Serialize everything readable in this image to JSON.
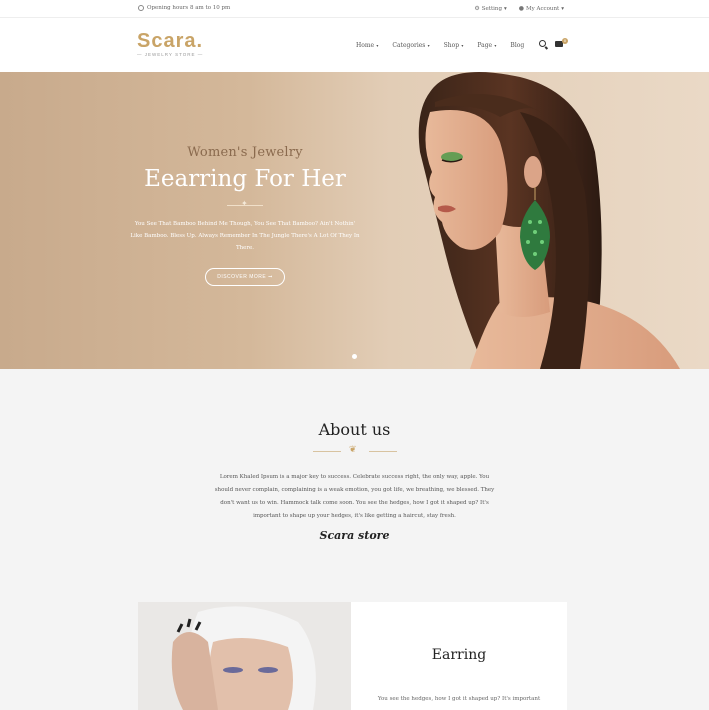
{
  "topbar": {
    "hours": "Opening hours 8 am to 10 pm",
    "setting": "Setting",
    "account": "My Account"
  },
  "header": {
    "logo": "Scara.",
    "tagline": "JEWELRY STORE",
    "nav": [
      "Home",
      "Categories",
      "Shop",
      "Page",
      "Blog"
    ],
    "cart_count": "0"
  },
  "hero": {
    "subtitle": "Women's Jewelry",
    "title": "Eearring For Her",
    "text": "You See That Bamboo Behind Me Though, You See That Bamboo? Ain't Nothin' Like Bamboo. Bless Up. Always Remember In The Jungle There's A Lot Of They In There.",
    "button": "DISCOVER MORE ➞"
  },
  "about": {
    "title": "About us",
    "text": "Lorem Khaled Ipsum is a major key to success. Celebrate success right, the only way, apple. You should never complain, complaining is a weak emotion, you got life, we breathing, we blessed. They don't want us to win. Hammock talk come soon. You see the hedges, how I got it shaped up? It's important to shape up your hedges, it's like getting a haircut, stay fresh.",
    "signature": "Scara store"
  },
  "card": {
    "title": "Earring",
    "text": "You see the hedges, how I got it shaped up? It's important"
  },
  "colors": {
    "accent": "#c9a467",
    "hero_bg": "#d4b89a"
  }
}
